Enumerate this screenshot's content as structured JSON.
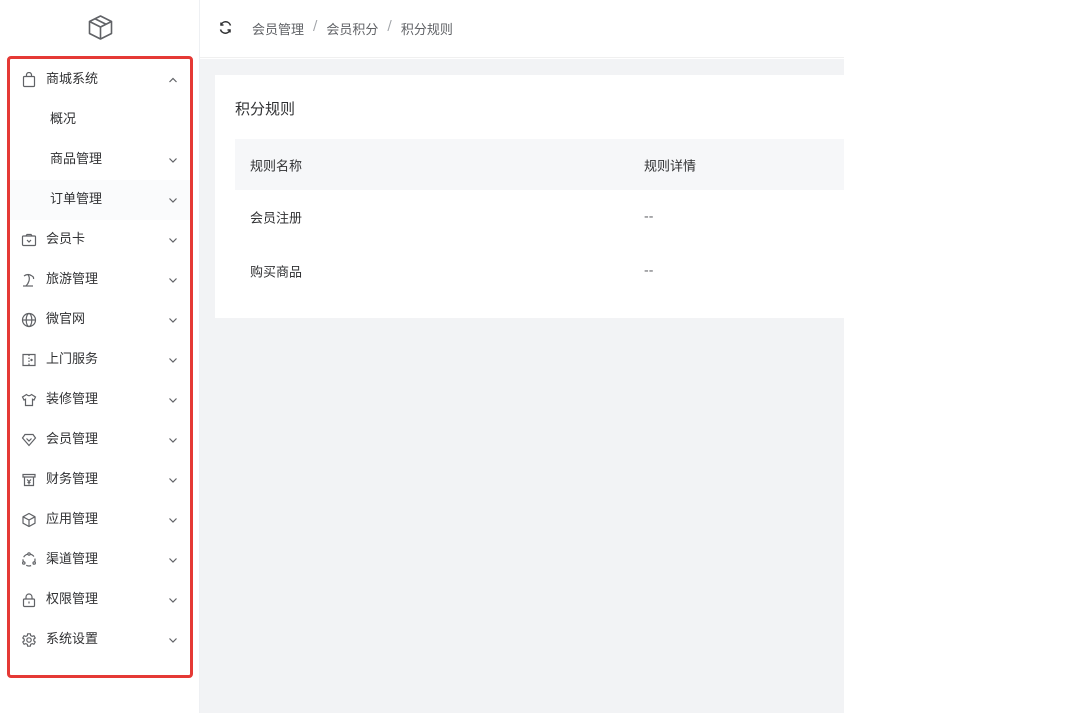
{
  "sidebar": {
    "logo": "cube-logo",
    "items": [
      {
        "label": "商城系统",
        "icon": "bag-icon",
        "chevron": "up"
      },
      {
        "label": "概况",
        "sub": true
      },
      {
        "label": "商品管理",
        "sub": true,
        "chevron": "down"
      },
      {
        "label": "订单管理",
        "sub": true,
        "chevron": "down"
      },
      {
        "label": "会员卡",
        "icon": "member-card-icon",
        "chevron": "down"
      },
      {
        "label": "旅游管理",
        "icon": "palm-tree-icon",
        "chevron": "down"
      },
      {
        "label": "微官网",
        "icon": "globe-icon",
        "chevron": "down"
      },
      {
        "label": "上门服务",
        "icon": "door-icon",
        "chevron": "down"
      },
      {
        "label": "装修管理",
        "icon": "shirt-icon",
        "chevron": "down"
      },
      {
        "label": "会员管理",
        "icon": "diamond-icon",
        "chevron": "down"
      },
      {
        "label": "财务管理",
        "icon": "finance-icon",
        "chevron": "down"
      },
      {
        "label": "应用管理",
        "icon": "box-icon",
        "chevron": "down"
      },
      {
        "label": "渠道管理",
        "icon": "channel-icon",
        "chevron": "down"
      },
      {
        "label": "权限管理",
        "icon": "lock-icon",
        "chevron": "down"
      },
      {
        "label": "系统设置",
        "icon": "gear-icon",
        "chevron": "down"
      }
    ]
  },
  "header": {
    "breadcrumb": [
      "会员管理",
      "会员积分",
      "积分规则"
    ],
    "separator": "/"
  },
  "card": {
    "title": "积分规则",
    "columns": [
      "规则名称",
      "规则详情"
    ],
    "rows": [
      {
        "name": "会员注册",
        "detail": "--"
      },
      {
        "name": "购买商品",
        "detail": "--"
      }
    ]
  },
  "colors": {
    "highlight": "#e53935",
    "content_bg": "#f2f3f5",
    "table_header_bg": "#f6f7f9"
  }
}
